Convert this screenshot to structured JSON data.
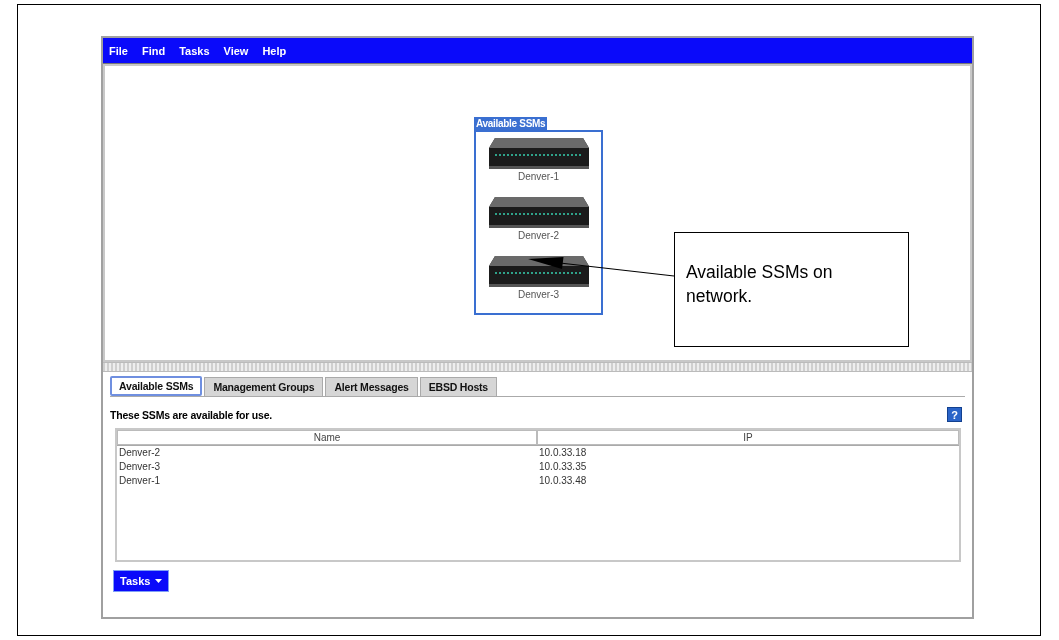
{
  "menu": [
    {
      "label": "File"
    },
    {
      "label": "Find"
    },
    {
      "label": "Tasks"
    },
    {
      "label": "View"
    },
    {
      "label": "Help"
    }
  ],
  "canvas": {
    "group_title": "Available SSMs",
    "devices": [
      {
        "name": "Denver-1"
      },
      {
        "name": "Denver-2"
      },
      {
        "name": "Denver-3"
      }
    ]
  },
  "callout": {
    "text": "Available SSMs on network."
  },
  "tabs": [
    {
      "label": "Available SSMs",
      "selected": true
    },
    {
      "label": "Management Groups",
      "selected": false
    },
    {
      "label": "Alert Messages",
      "selected": false
    },
    {
      "label": "EBSD Hosts",
      "selected": false
    }
  ],
  "description": "These SSMs are available for use.",
  "help_button": {
    "label": "?"
  },
  "table": {
    "columns": [
      "Name",
      "IP"
    ],
    "rows": [
      [
        "Denver-2",
        "10.0.33.18"
      ],
      [
        "Denver-3",
        "10.0.33.35"
      ],
      [
        "Denver-1",
        "10.0.33.48"
      ]
    ]
  },
  "tasks_button": {
    "label": "Tasks"
  }
}
